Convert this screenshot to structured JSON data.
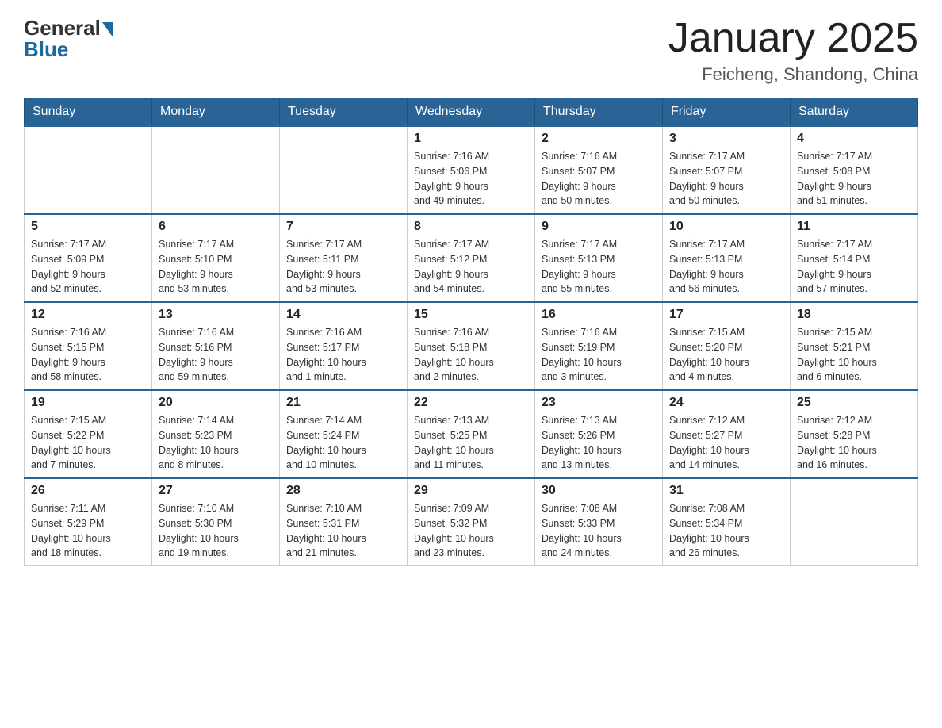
{
  "header": {
    "logo_general": "General",
    "logo_blue": "Blue",
    "title": "January 2025",
    "subtitle": "Feicheng, Shandong, China"
  },
  "weekdays": [
    "Sunday",
    "Monday",
    "Tuesday",
    "Wednesday",
    "Thursday",
    "Friday",
    "Saturday"
  ],
  "weeks": [
    [
      {
        "day": "",
        "info": ""
      },
      {
        "day": "",
        "info": ""
      },
      {
        "day": "",
        "info": ""
      },
      {
        "day": "1",
        "info": "Sunrise: 7:16 AM\nSunset: 5:06 PM\nDaylight: 9 hours\nand 49 minutes."
      },
      {
        "day": "2",
        "info": "Sunrise: 7:16 AM\nSunset: 5:07 PM\nDaylight: 9 hours\nand 50 minutes."
      },
      {
        "day": "3",
        "info": "Sunrise: 7:17 AM\nSunset: 5:07 PM\nDaylight: 9 hours\nand 50 minutes."
      },
      {
        "day": "4",
        "info": "Sunrise: 7:17 AM\nSunset: 5:08 PM\nDaylight: 9 hours\nand 51 minutes."
      }
    ],
    [
      {
        "day": "5",
        "info": "Sunrise: 7:17 AM\nSunset: 5:09 PM\nDaylight: 9 hours\nand 52 minutes."
      },
      {
        "day": "6",
        "info": "Sunrise: 7:17 AM\nSunset: 5:10 PM\nDaylight: 9 hours\nand 53 minutes."
      },
      {
        "day": "7",
        "info": "Sunrise: 7:17 AM\nSunset: 5:11 PM\nDaylight: 9 hours\nand 53 minutes."
      },
      {
        "day": "8",
        "info": "Sunrise: 7:17 AM\nSunset: 5:12 PM\nDaylight: 9 hours\nand 54 minutes."
      },
      {
        "day": "9",
        "info": "Sunrise: 7:17 AM\nSunset: 5:13 PM\nDaylight: 9 hours\nand 55 minutes."
      },
      {
        "day": "10",
        "info": "Sunrise: 7:17 AM\nSunset: 5:13 PM\nDaylight: 9 hours\nand 56 minutes."
      },
      {
        "day": "11",
        "info": "Sunrise: 7:17 AM\nSunset: 5:14 PM\nDaylight: 9 hours\nand 57 minutes."
      }
    ],
    [
      {
        "day": "12",
        "info": "Sunrise: 7:16 AM\nSunset: 5:15 PM\nDaylight: 9 hours\nand 58 minutes."
      },
      {
        "day": "13",
        "info": "Sunrise: 7:16 AM\nSunset: 5:16 PM\nDaylight: 9 hours\nand 59 minutes."
      },
      {
        "day": "14",
        "info": "Sunrise: 7:16 AM\nSunset: 5:17 PM\nDaylight: 10 hours\nand 1 minute."
      },
      {
        "day": "15",
        "info": "Sunrise: 7:16 AM\nSunset: 5:18 PM\nDaylight: 10 hours\nand 2 minutes."
      },
      {
        "day": "16",
        "info": "Sunrise: 7:16 AM\nSunset: 5:19 PM\nDaylight: 10 hours\nand 3 minutes."
      },
      {
        "day": "17",
        "info": "Sunrise: 7:15 AM\nSunset: 5:20 PM\nDaylight: 10 hours\nand 4 minutes."
      },
      {
        "day": "18",
        "info": "Sunrise: 7:15 AM\nSunset: 5:21 PM\nDaylight: 10 hours\nand 6 minutes."
      }
    ],
    [
      {
        "day": "19",
        "info": "Sunrise: 7:15 AM\nSunset: 5:22 PM\nDaylight: 10 hours\nand 7 minutes."
      },
      {
        "day": "20",
        "info": "Sunrise: 7:14 AM\nSunset: 5:23 PM\nDaylight: 10 hours\nand 8 minutes."
      },
      {
        "day": "21",
        "info": "Sunrise: 7:14 AM\nSunset: 5:24 PM\nDaylight: 10 hours\nand 10 minutes."
      },
      {
        "day": "22",
        "info": "Sunrise: 7:13 AM\nSunset: 5:25 PM\nDaylight: 10 hours\nand 11 minutes."
      },
      {
        "day": "23",
        "info": "Sunrise: 7:13 AM\nSunset: 5:26 PM\nDaylight: 10 hours\nand 13 minutes."
      },
      {
        "day": "24",
        "info": "Sunrise: 7:12 AM\nSunset: 5:27 PM\nDaylight: 10 hours\nand 14 minutes."
      },
      {
        "day": "25",
        "info": "Sunrise: 7:12 AM\nSunset: 5:28 PM\nDaylight: 10 hours\nand 16 minutes."
      }
    ],
    [
      {
        "day": "26",
        "info": "Sunrise: 7:11 AM\nSunset: 5:29 PM\nDaylight: 10 hours\nand 18 minutes."
      },
      {
        "day": "27",
        "info": "Sunrise: 7:10 AM\nSunset: 5:30 PM\nDaylight: 10 hours\nand 19 minutes."
      },
      {
        "day": "28",
        "info": "Sunrise: 7:10 AM\nSunset: 5:31 PM\nDaylight: 10 hours\nand 21 minutes."
      },
      {
        "day": "29",
        "info": "Sunrise: 7:09 AM\nSunset: 5:32 PM\nDaylight: 10 hours\nand 23 minutes."
      },
      {
        "day": "30",
        "info": "Sunrise: 7:08 AM\nSunset: 5:33 PM\nDaylight: 10 hours\nand 24 minutes."
      },
      {
        "day": "31",
        "info": "Sunrise: 7:08 AM\nSunset: 5:34 PM\nDaylight: 10 hours\nand 26 minutes."
      },
      {
        "day": "",
        "info": ""
      }
    ]
  ]
}
